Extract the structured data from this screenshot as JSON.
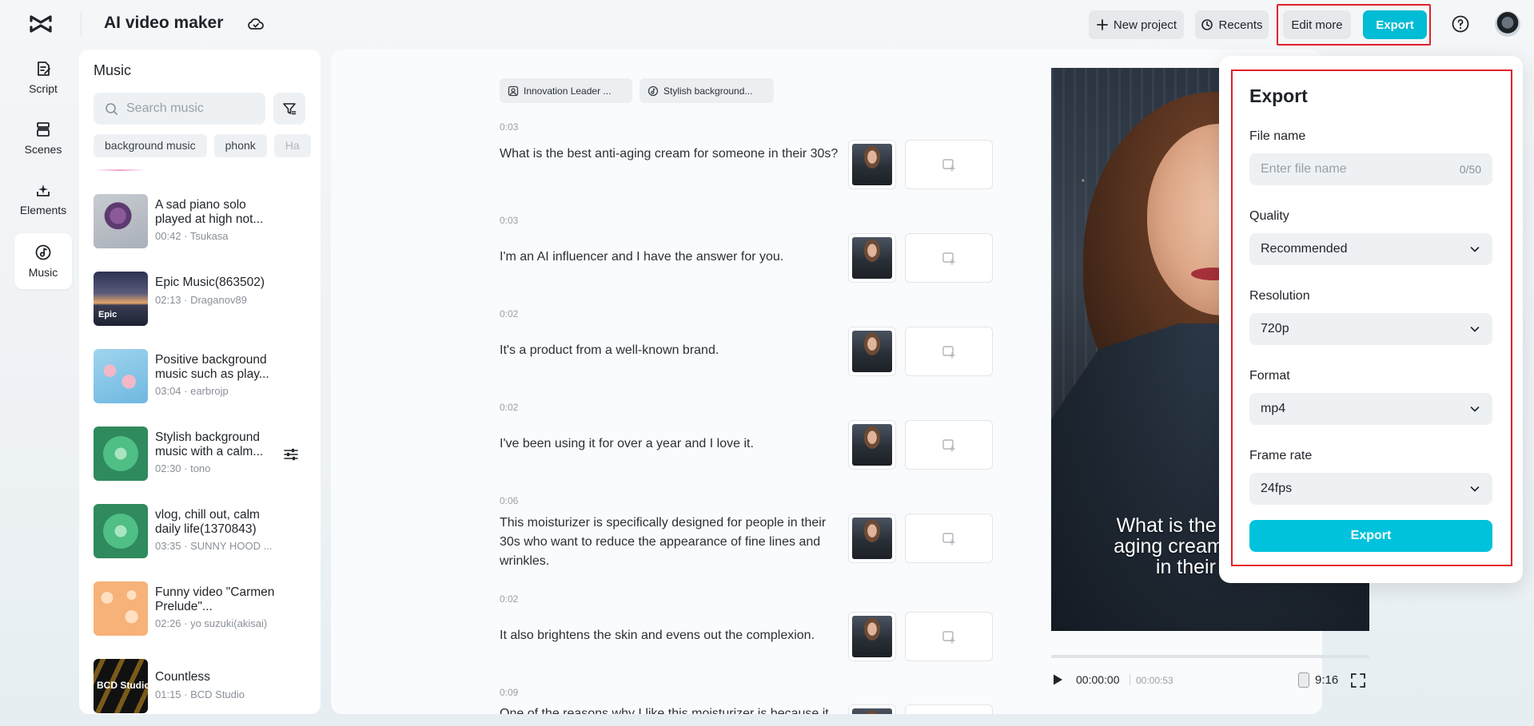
{
  "header": {
    "app_title": "AI video maker",
    "new_project": "New project",
    "recents": "Recents",
    "edit_more": "Edit more",
    "export": "Export"
  },
  "rail": [
    {
      "label": "Script",
      "icon": "script-icon"
    },
    {
      "label": "Scenes",
      "icon": "scenes-icon"
    },
    {
      "label": "Elements",
      "icon": "elements-icon"
    },
    {
      "label": "Music",
      "icon": "music-icon",
      "active": true
    }
  ],
  "music": {
    "title": "Music",
    "search_placeholder": "Search music",
    "tags": [
      "background music",
      "phonk",
      "Ha"
    ],
    "tracks": [
      {
        "name": "A sad piano solo played at high not...",
        "meta": "00:42 · Tsukasa"
      },
      {
        "name": "Epic Music(863502)",
        "meta": "02:13 · Draganov89",
        "thumb_text": "Epic"
      },
      {
        "name": "Positive background music such as play...",
        "meta": "03:04 · earbrojp"
      },
      {
        "name": "Stylish background music with a calm...",
        "meta": "02:30 · tono"
      },
      {
        "name": "vlog, chill out, calm daily life(1370843)",
        "meta": "03:35 · SUNNY HOOD ..."
      },
      {
        "name": "Funny video \"Carmen Prelude\"...",
        "meta": "02:26 · yo suzuki(akisai)"
      },
      {
        "name": "Countless",
        "meta": "01:15 · BCD Studio",
        "thumb_text": "BCD Studio"
      }
    ]
  },
  "script": {
    "chips": [
      "Innovation Leader ...",
      "Stylish background..."
    ],
    "scenes": [
      {
        "time": "0:03",
        "text": "What is the best anti-aging cream for someone in their 30s?"
      },
      {
        "time": "0:03",
        "text": "I'm an AI influencer and I have the answer for you."
      },
      {
        "time": "0:02",
        "text": "It's a product from a well-known brand."
      },
      {
        "time": "0:02",
        "text": "I've been using it for over a year and I love it."
      },
      {
        "time": "0:06",
        "text": "This moisturizer is specifically designed for people in their 30s who want to reduce the appearance of fine lines and wrinkles."
      },
      {
        "time": "0:02",
        "text": "It also brightens the skin and evens out the complexion."
      },
      {
        "time": "0:09",
        "text": "One of the reasons why I like this moisturizer is because it"
      }
    ]
  },
  "preview": {
    "caption": "What is the best anti-\naging cream for some\nin their 30s?",
    "current_time": "00:00:00",
    "total_time": "00:00:53",
    "ratio": "9:16",
    "progress": 0
  },
  "export_panel": {
    "title": "Export",
    "file_name_label": "File name",
    "file_name_placeholder": "Enter file name",
    "file_name_count": "0/50",
    "quality_label": "Quality",
    "quality_value": "Recommended",
    "resolution_label": "Resolution",
    "resolution_value": "720p",
    "format_label": "Format",
    "format_value": "mp4",
    "frame_rate_label": "Frame rate",
    "frame_rate_value": "24fps",
    "export_button": "Export"
  },
  "colors": {
    "accent": "#00bcd4",
    "highlight": "#e0202a"
  }
}
